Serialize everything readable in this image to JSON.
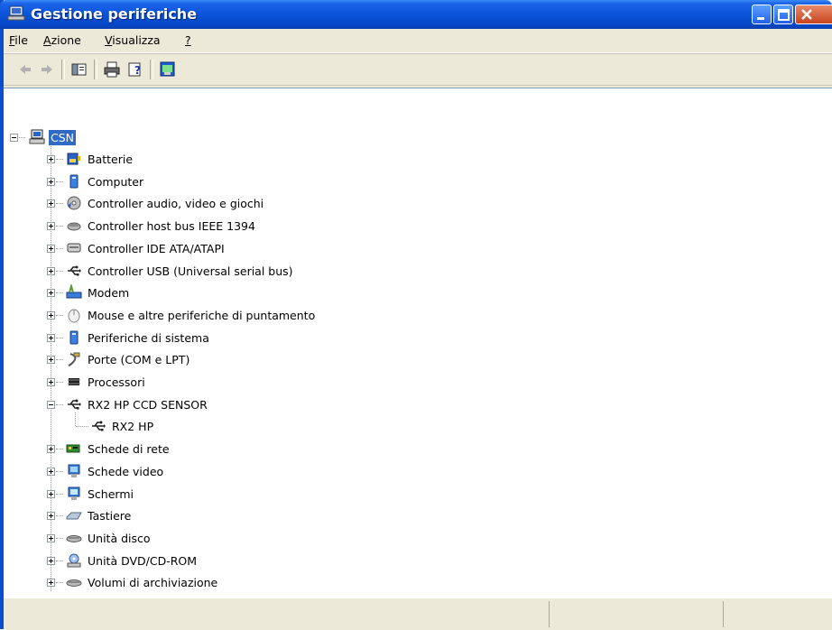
{
  "window": {
    "title": "Gestione periferiche"
  },
  "menu": {
    "items": [
      {
        "label_pre": "",
        "label_ul": "F",
        "label_post": "ile"
      },
      {
        "label_pre": "",
        "label_ul": "A",
        "label_post": "zione"
      },
      {
        "label_pre": "",
        "label_ul": "V",
        "label_post": "isualizza"
      },
      {
        "label_pre": "",
        "label_ul": "?",
        "label_post": ""
      }
    ]
  },
  "toolbar": {
    "buttons": [
      "back-arrow-icon",
      "forward-arrow-icon",
      "show-hide-console-tree-icon",
      "print-icon",
      "help-icon",
      "properties-icon"
    ]
  },
  "tree": {
    "root": "CSN",
    "categories": [
      {
        "label": "Batterie",
        "icon": "battery-icon"
      },
      {
        "label": "Computer",
        "icon": "computer-icon"
      },
      {
        "label": "Controller audio, video e giochi",
        "icon": "audio-icon"
      },
      {
        "label": "Controller host bus IEEE 1394",
        "icon": "firewire-icon"
      },
      {
        "label": "Controller IDE ATA/ATAPI",
        "icon": "ide-controller-icon"
      },
      {
        "label": "Controller USB (Universal serial bus)",
        "icon": "usb-icon"
      },
      {
        "label": "Modem",
        "icon": "modem-icon"
      },
      {
        "label": "Mouse e altre periferiche di puntamento",
        "icon": "mouse-icon"
      },
      {
        "label": "Periferiche di sistema",
        "icon": "system-device-icon"
      },
      {
        "label": "Porte (COM e LPT)",
        "icon": "port-icon"
      },
      {
        "label": "Processori",
        "icon": "processor-icon"
      },
      {
        "label": "RX2 HP CCD SENSOR",
        "icon": "usb-icon",
        "expanded": true,
        "children": [
          "RX2 HP"
        ]
      },
      {
        "label": "Schede di rete",
        "icon": "network-card-icon"
      },
      {
        "label": "Schede video",
        "icon": "display-adapter-icon"
      },
      {
        "label": "Schermi",
        "icon": "monitor-icon"
      },
      {
        "label": "Tastiere",
        "icon": "keyboard-icon"
      },
      {
        "label": "Unità disco",
        "icon": "disk-drive-icon"
      },
      {
        "label": "Unità DVD/CD-ROM",
        "icon": "dvd-drive-icon"
      },
      {
        "label": "Volumi di archiviazione",
        "icon": "storage-volume-icon"
      }
    ]
  },
  "colors": {
    "titlebar": "#0A53D8",
    "selection": "#316AC5",
    "chrome": "#ECE9D8"
  }
}
